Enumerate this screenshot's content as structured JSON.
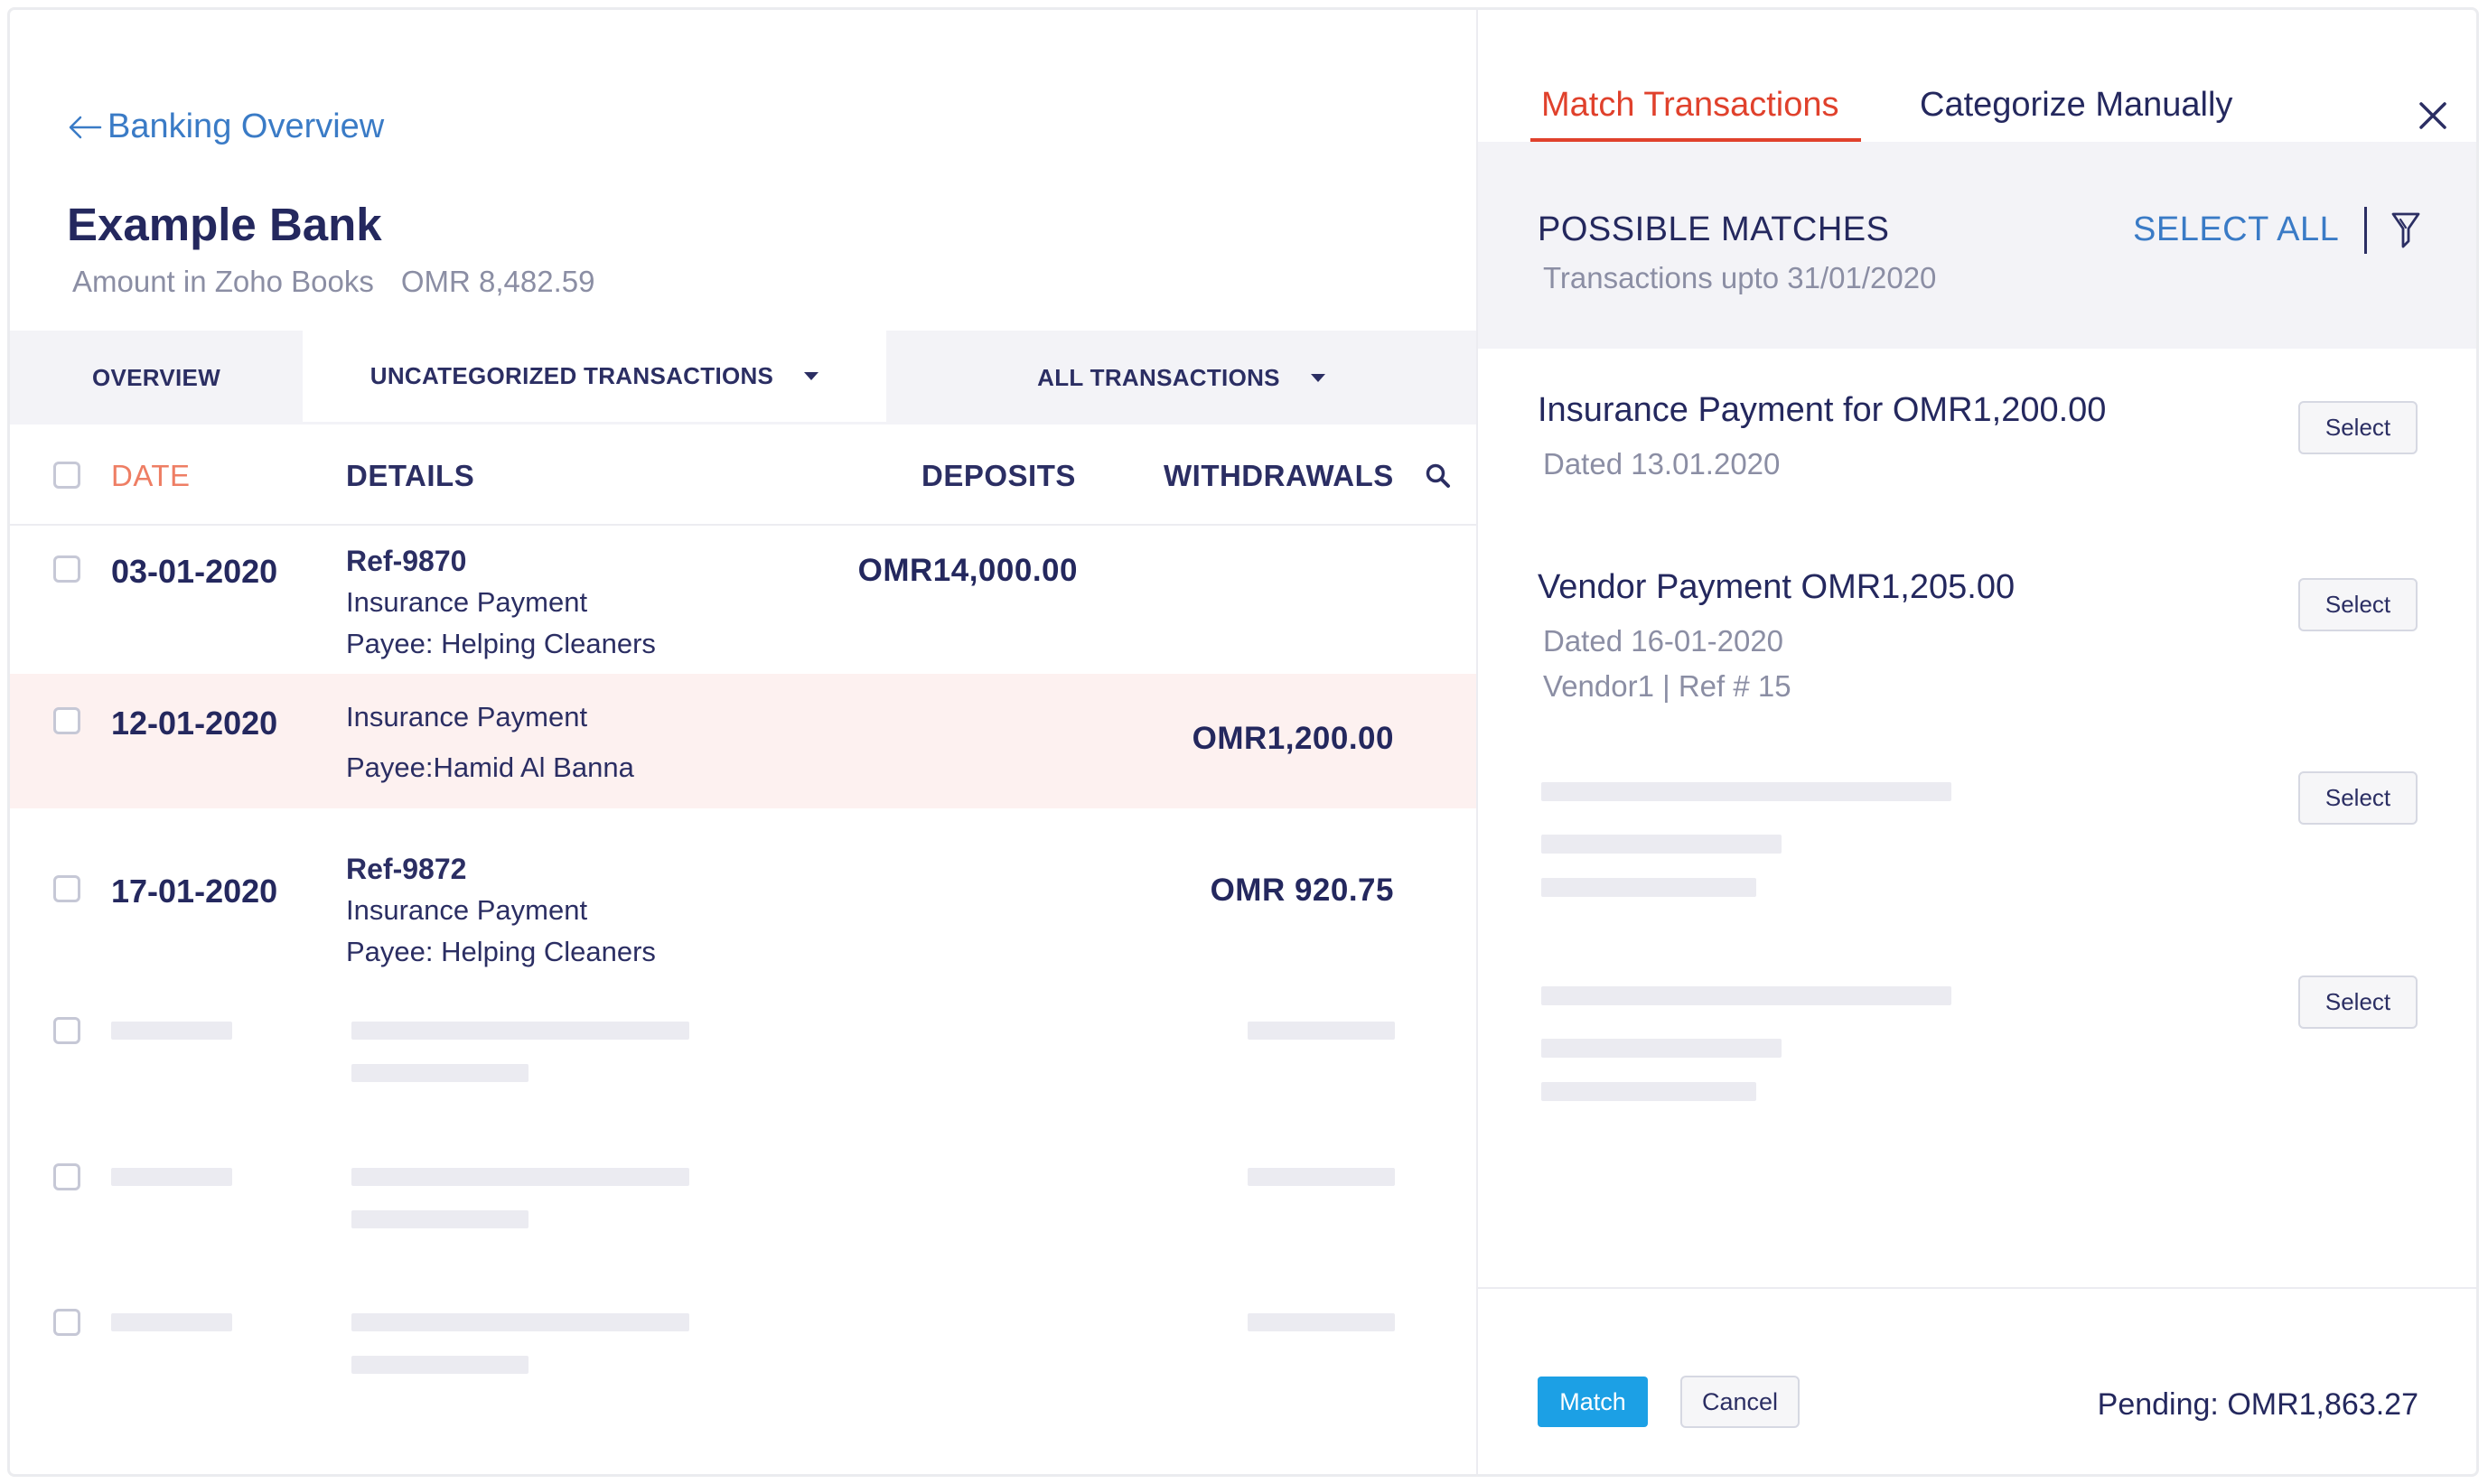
{
  "left": {
    "back_label": "Banking Overview",
    "bank_name": "Example Bank",
    "amount_label": "Amount in Zoho Books",
    "amount_value": "OMR 8,482.59",
    "tabs": {
      "overview": "OVERVIEW",
      "uncategorized": "UNCATEGORIZED TRANSACTIONS",
      "all": "ALL TRANSACTIONS"
    },
    "columns": {
      "date": "DATE",
      "details": "DETAILS",
      "deposits": "DEPOSITS",
      "withdrawals": "WITHDRAWALS"
    },
    "rows": [
      {
        "date": "03-01-2020",
        "ref": "Ref-9870",
        "desc": "Insurance Payment",
        "payee": "Payee: Helping Cleaners",
        "deposit": "OMR14,000.00",
        "withdrawal": ""
      },
      {
        "date": "12-01-2020",
        "ref": "",
        "desc": "Insurance Payment",
        "payee": "Payee:Hamid Al Banna",
        "deposit": "",
        "withdrawal": "OMR1,200.00"
      },
      {
        "date": "17-01-2020",
        "ref": "Ref-9872",
        "desc": "Insurance Payment",
        "payee": "Payee: Helping Cleaners",
        "deposit": "",
        "withdrawal": "OMR 920.75"
      }
    ]
  },
  "right": {
    "tabs": {
      "match": "Match Transactions",
      "categorize": "Categorize Manually"
    },
    "header": {
      "title": "POSSIBLE MATCHES",
      "subtitle": "Transactions upto 31/01/2020",
      "select_all": "SELECT ALL"
    },
    "matches": [
      {
        "title": "Insurance Payment for OMR1,200.00",
        "dated": "Dated 13.01.2020",
        "extra": ""
      },
      {
        "title": "Vendor Payment OMR1,205.00",
        "dated": "Dated 16-01-2020",
        "extra": "Vendor1 | Ref # 15"
      }
    ],
    "select_label": "Select",
    "match_button": "Match",
    "cancel_button": "Cancel",
    "pending": "Pending: OMR1,863.27"
  },
  "colors": {
    "accent_red": "#e0412c",
    "link_blue": "#3a7bc6",
    "primary_button": "#1ca0e5",
    "highlight_row": "#fdf1f0",
    "navy_text": "#24285e"
  },
  "icons": [
    "arrow-left-icon",
    "caret-down-icon",
    "search-icon",
    "close-icon",
    "filter-icon",
    "checkbox-icon"
  ]
}
